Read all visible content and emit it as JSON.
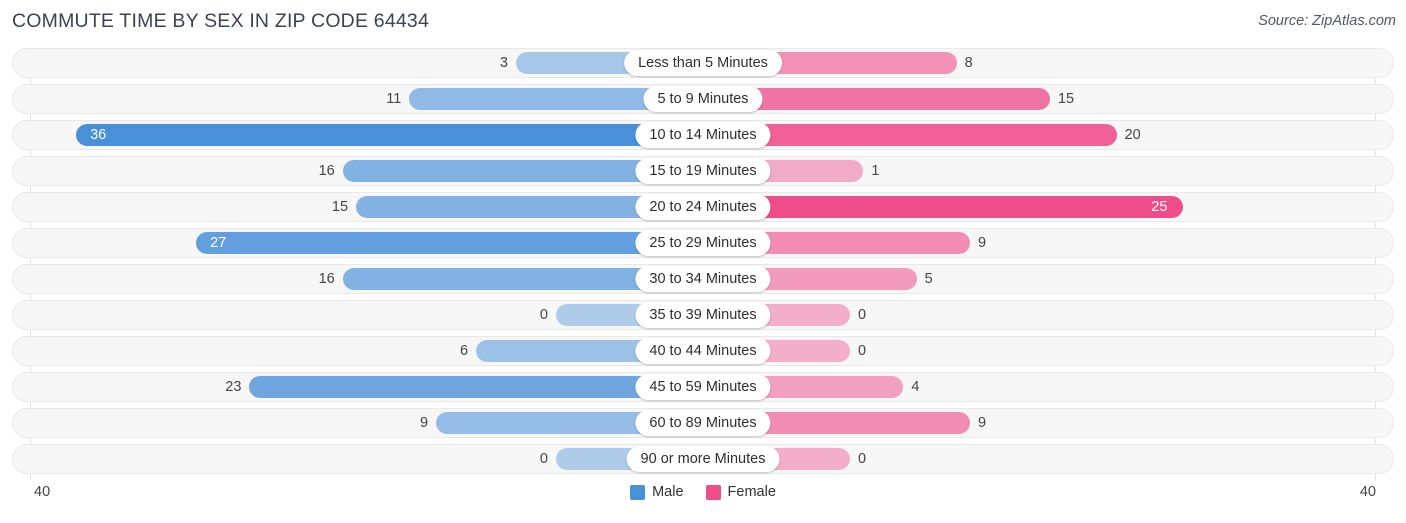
{
  "header": {
    "title": "COMMUTE TIME BY SEX IN ZIP CODE 64434",
    "source": "Source: ZipAtlas.com"
  },
  "axis": {
    "left_max": "40",
    "right_max": "40"
  },
  "legend": {
    "items": [
      {
        "label": "Male",
        "color": "#4a90d9"
      },
      {
        "label": "Female",
        "color": "#ee4d8a"
      }
    ]
  },
  "chart_data": {
    "type": "bar",
    "subtype": "diverging-bidirectional",
    "title": "COMMUTE TIME BY SEX IN ZIP CODE 64434",
    "xlabel": "",
    "ylabel": "",
    "xlim": [
      40,
      40
    ],
    "grid": true,
    "legend_position": "bottom-center",
    "categories": [
      "Less than 5 Minutes",
      "5 to 9 Minutes",
      "10 to 14 Minutes",
      "15 to 19 Minutes",
      "20 to 24 Minutes",
      "25 to 29 Minutes",
      "30 to 34 Minutes",
      "35 to 39 Minutes",
      "40 to 44 Minutes",
      "45 to 59 Minutes",
      "60 to 89 Minutes",
      "90 or more Minutes"
    ],
    "series": [
      {
        "name": "Male",
        "color": "#4a90d9",
        "direction": "left",
        "values": [
          3,
          11,
          36,
          16,
          15,
          27,
          16,
          0,
          6,
          23,
          9,
          0
        ]
      },
      {
        "name": "Female",
        "color": "#ee4d8a",
        "direction": "right",
        "values": [
          8,
          15,
          20,
          1,
          25,
          9,
          5,
          0,
          0,
          4,
          9,
          0
        ]
      }
    ]
  },
  "rows": [
    {
      "label": "Less than 5 Minutes",
      "male": "3",
      "female": "8"
    },
    {
      "label": "5 to 9 Minutes",
      "male": "11",
      "female": "15"
    },
    {
      "label": "10 to 14 Minutes",
      "male": "36",
      "female": "20"
    },
    {
      "label": "15 to 19 Minutes",
      "male": "16",
      "female": "1"
    },
    {
      "label": "20 to 24 Minutes",
      "male": "15",
      "female": "25"
    },
    {
      "label": "25 to 29 Minutes",
      "male": "27",
      "female": "9"
    },
    {
      "label": "30 to 34 Minutes",
      "male": "16",
      "female": "5"
    },
    {
      "label": "35 to 39 Minutes",
      "male": "0",
      "female": "0"
    },
    {
      "label": "40 to 44 Minutes",
      "male": "6",
      "female": "0"
    },
    {
      "label": "45 to 59 Minutes",
      "male": "23",
      "female": "4"
    },
    {
      "label": "60 to 89 Minutes",
      "male": "9",
      "female": "9"
    },
    {
      "label": "90 or more Minutes",
      "male": "0",
      "female": "0"
    }
  ]
}
